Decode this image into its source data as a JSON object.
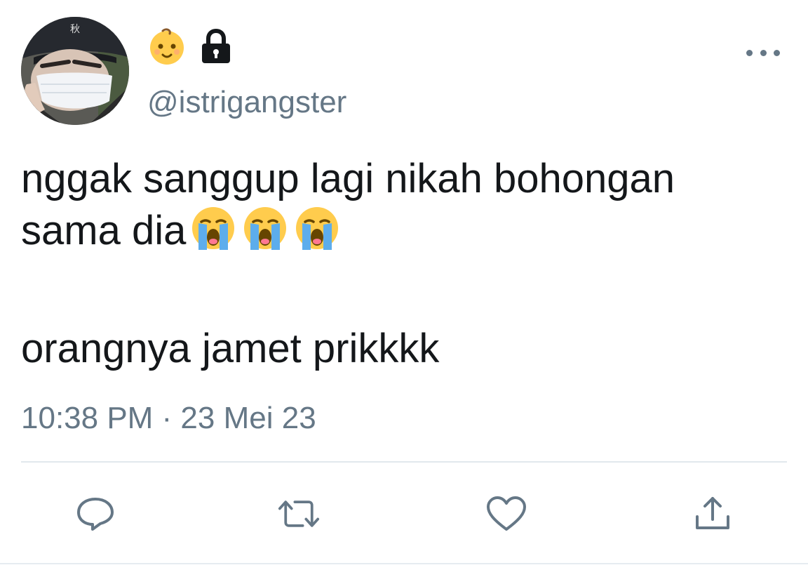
{
  "tweet": {
    "handle": "@istrigangster",
    "name_emojis": [
      "baby-face-emoji",
      "lock-icon"
    ],
    "text_line_1": "nggak sanggup lagi nikah bohongan",
    "text_line_2": "sama dia",
    "text_line_2_emojis": [
      "loudly-crying-face-emoji",
      "loudly-crying-face-emoji",
      "loudly-crying-face-emoji"
    ],
    "text_line_3": "orangnya jamet prikkkk",
    "timestamp": "10:38 PM · 23 Mei 23",
    "avatar_hat_text": "秋"
  },
  "actions": [
    {
      "name": "reply",
      "icon": "speech-bubble-icon"
    },
    {
      "name": "retweet",
      "icon": "retweet-icon"
    },
    {
      "name": "like",
      "icon": "heart-icon"
    },
    {
      "name": "share",
      "icon": "share-icon"
    }
  ],
  "colors": {
    "text": "#14171a",
    "secondary": "#657786",
    "divider": "#e1e8ed"
  }
}
